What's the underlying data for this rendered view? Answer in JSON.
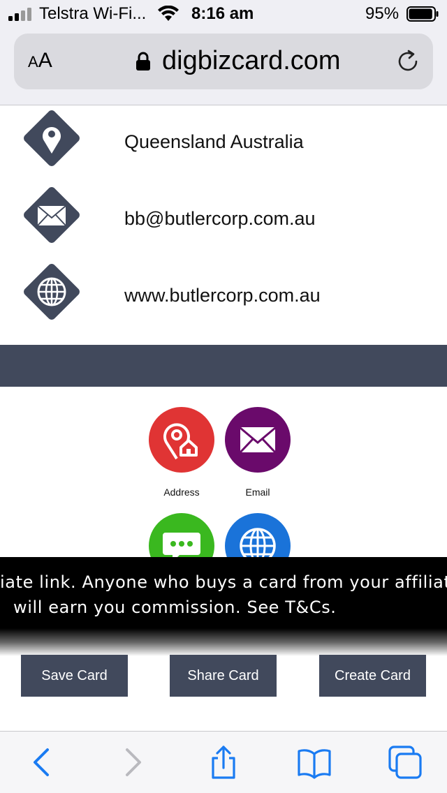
{
  "status_bar": {
    "carrier": "Telstra Wi-Fi...",
    "time": "8:16 am",
    "battery_percent": "95%",
    "battery_level": 0.95,
    "signal_icon": "cellular-signal-icon",
    "wifi_icon": "wifi-icon",
    "battery_icon": "battery-icon"
  },
  "url_bar": {
    "text_size_small": "A",
    "text_size_large": "A",
    "domain": "digbizcard.com",
    "lock_icon": "lock-icon",
    "reload_icon": "reload-icon"
  },
  "contacts": [
    {
      "icon": "location-pin-icon",
      "text": "Queensland Australia"
    },
    {
      "icon": "envelope-icon",
      "text": "bb@butlercorp.com.au"
    },
    {
      "icon": "globe-icon",
      "text": "www.butlercorp.com.au"
    }
  ],
  "actions": [
    {
      "icon": "address-home-pin-icon",
      "label": "Address",
      "color": "#e03434"
    },
    {
      "icon": "envelope-icon",
      "label": "Email",
      "color": "#6a0a6b"
    },
    {
      "icon": "chat-icon",
      "label": "",
      "color": "#3ab81f"
    },
    {
      "icon": "globe-icon",
      "label": "",
      "color": "#1a73d9"
    }
  ],
  "banner": {
    "line1": "iate link. Anyone who buys a card from your affiliate",
    "line2": "will earn you commission. See T&Cs."
  },
  "card_buttons": {
    "save": "Save Card",
    "share": "Share Card",
    "create": "Create Card"
  },
  "toolbar": {
    "back_icon": "back-chevron-icon",
    "forward_icon": "forward-chevron-icon",
    "share_icon": "share-icon",
    "bookmarks_icon": "bookmarks-book-icon",
    "tabs_icon": "tabs-icon"
  },
  "colors": {
    "accent_dark": "#41495c",
    "ios_blue": "#1a7bf2",
    "chrome_bg": "#efeff4"
  }
}
